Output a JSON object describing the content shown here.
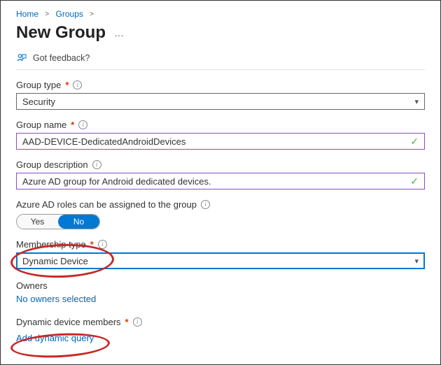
{
  "breadcrumb": {
    "home": "Home",
    "groups": "Groups"
  },
  "page_title": "New Group",
  "feedback_label": "Got feedback?",
  "group_type": {
    "label": "Group type",
    "value": "Security"
  },
  "group_name": {
    "label": "Group name",
    "value": "AAD-DEVICE-DedicatedAndroidDevices"
  },
  "group_desc": {
    "label": "Group description",
    "value": "Azure AD group for Android dedicated devices."
  },
  "aad_roles": {
    "label": "Azure AD roles can be assigned to the group",
    "yes": "Yes",
    "no": "No"
  },
  "membership": {
    "label": "Membership type",
    "value": "Dynamic Device"
  },
  "owners": {
    "label": "Owners",
    "empty": "No owners selected"
  },
  "dyn_members": {
    "label": "Dynamic device members",
    "action": "Add dynamic query"
  }
}
